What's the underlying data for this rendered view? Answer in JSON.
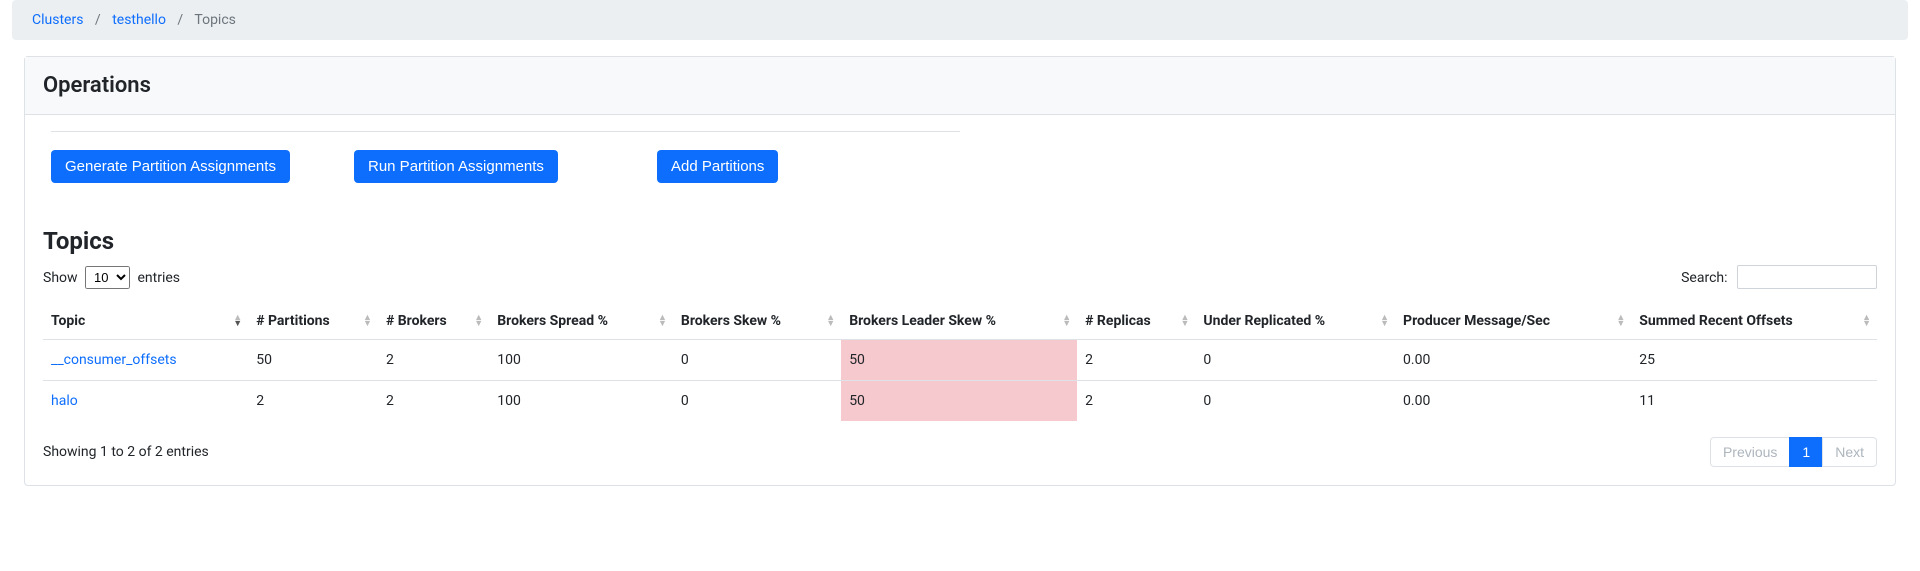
{
  "breadcrumb": {
    "items": [
      {
        "label": "Clusters",
        "link": true
      },
      {
        "label": "testhello",
        "link": true
      },
      {
        "label": "Topics",
        "link": false
      }
    ]
  },
  "operations": {
    "title": "Operations",
    "buttons": {
      "generate": "Generate Partition Assignments",
      "run": "Run Partition Assignments",
      "add": "Add Partitions"
    }
  },
  "topics": {
    "title": "Topics",
    "show_label_pre": "Show",
    "show_label_post": "entries",
    "show_value": "10",
    "search_label": "Search:",
    "search_value": "",
    "columns": [
      "Topic",
      "# Partitions",
      "# Brokers",
      "Brokers Spread %",
      "Brokers Skew %",
      "Brokers Leader Skew %",
      "# Replicas",
      "Under Replicated %",
      "Producer Message/Sec",
      "Summed Recent Offsets"
    ],
    "rows": [
      {
        "topic": "__consumer_offsets",
        "partitions": "50",
        "brokers": "2",
        "spread": "100",
        "skew": "0",
        "leader_skew": "50",
        "leader_skew_warn": true,
        "replicas": "2",
        "under_replicated": "0",
        "producer_msg_sec": "0.00",
        "summed_recent_offsets": "25"
      },
      {
        "topic": "halo",
        "partitions": "2",
        "brokers": "2",
        "spread": "100",
        "skew": "0",
        "leader_skew": "50",
        "leader_skew_warn": true,
        "replicas": "2",
        "under_replicated": "0",
        "producer_msg_sec": "0.00",
        "summed_recent_offsets": "11"
      }
    ],
    "info_text": "Showing 1 to 2 of 2 entries",
    "pagination": {
      "previous": "Previous",
      "pages": [
        "1"
      ],
      "active_index": 0,
      "next": "Next"
    }
  }
}
